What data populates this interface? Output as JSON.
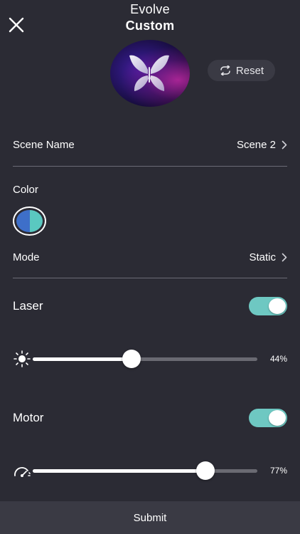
{
  "header": {
    "line1": "Evolve",
    "line2": "Custom"
  },
  "reset": {
    "label": "Reset"
  },
  "scene_name": {
    "label": "Scene Name",
    "value": "Scene 2"
  },
  "color": {
    "label": "Color",
    "left": "#3e6fc9",
    "right": "#5ac8c0"
  },
  "mode": {
    "label": "Mode",
    "value": "Static"
  },
  "laser": {
    "label": "Laser",
    "enabled": true,
    "brightness_label": "44%",
    "brightness": 0.44
  },
  "motor": {
    "label": "Motor",
    "enabled": true,
    "speed_label": "77%",
    "speed": 0.77
  },
  "submit": {
    "label": "Submit"
  },
  "icons": [
    "close-icon",
    "butterfly-icon",
    "reset-icon",
    "chevron-right-icon",
    "brightness-icon",
    "speedometer-icon"
  ],
  "accent": "#6ec8c2"
}
